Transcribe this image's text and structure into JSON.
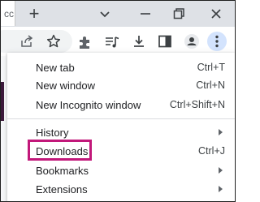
{
  "tabstrip": {
    "tab_fragment": "cc",
    "new_tab_symbol": "+",
    "icons": [
      "chevron-down-icon",
      "minimize-icon",
      "restore-icon",
      "close-icon"
    ]
  },
  "toolbar": {
    "icons": [
      "share-icon",
      "bookmark-star-icon",
      "extensions-icon",
      "media-controls-icon",
      "downloads-icon",
      "side-panel-icon",
      "profile-icon",
      "more-menu-icon"
    ]
  },
  "menu": {
    "items": [
      {
        "label": "New tab",
        "shortcut": "Ctrl+T"
      },
      {
        "label": "New window",
        "shortcut": "Ctrl+N"
      },
      {
        "label": "New Incognito window",
        "shortcut": "Ctrl+Shift+N"
      },
      {
        "label": "History",
        "shortcut": ""
      },
      {
        "label": "Downloads",
        "shortcut": "Ctrl+J"
      },
      {
        "label": "Bookmarks",
        "shortcut": ""
      },
      {
        "label": "Extensions",
        "shortcut": ""
      }
    ]
  },
  "colors": {
    "highlight": "#c2187a",
    "tabstrip_bg": "#dee1e6",
    "page_accent": "#3d1a3b"
  }
}
